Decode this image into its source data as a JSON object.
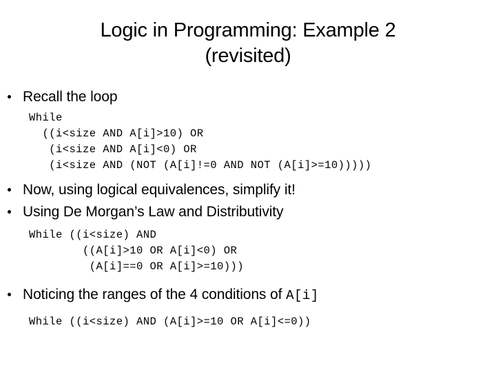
{
  "slide": {
    "background_color": "#ffffff",
    "text_color": "#000000",
    "title": "Logic in Programming: Example 2\n(revisited)",
    "bullets": {
      "recall": "Recall the loop",
      "simplify": "Now, using logical equivalences, simplify it!",
      "demorgan": "Using De Morgan’s Law and Distributivity",
      "noticing_prefix": "Noticing the ranges of the 4 conditions of ",
      "noticing_code": "A[i]"
    },
    "code_block_1": {
      "line1": "While",
      "line2": "  ((i<size AND A[i]>10) OR",
      "line3": "   (i<size AND A[i]<0) OR",
      "line4": "   (i<size AND (NOT (A[i]!=0 AND NOT (A[i]>=10)))))"
    },
    "code_block_2": {
      "line1": "While ((i<size) AND",
      "line2": "        ((A[i]>10 OR A[i]<0) OR",
      "line3": "         (A[i]==0 OR A[i]>=10)))"
    },
    "code_block_3": {
      "line1": "While ((i<size) AND (A[i]>=10 OR A[i]<=0))"
    },
    "bullet_glyph": "round-dot"
  }
}
